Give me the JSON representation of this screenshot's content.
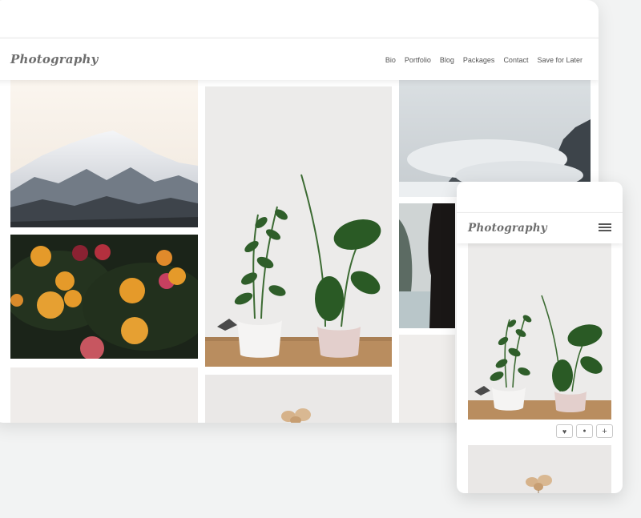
{
  "desktop": {
    "logo": "Photography",
    "nav": [
      "Bio",
      "Portfolio",
      "Blog",
      "Packages",
      "Contact",
      "Save for Later"
    ]
  },
  "mobile": {
    "logo": "Photography",
    "actions": {
      "like": "♥",
      "comment": "●",
      "add": "+"
    }
  },
  "icons": [
    "hamburger-menu-icon",
    "heart-icon",
    "comment-icon",
    "plus-icon"
  ],
  "colors": {
    "background": "#f2f3f3",
    "card": "#ffffff",
    "text": "#555555",
    "logo": "#6e6e6e"
  }
}
